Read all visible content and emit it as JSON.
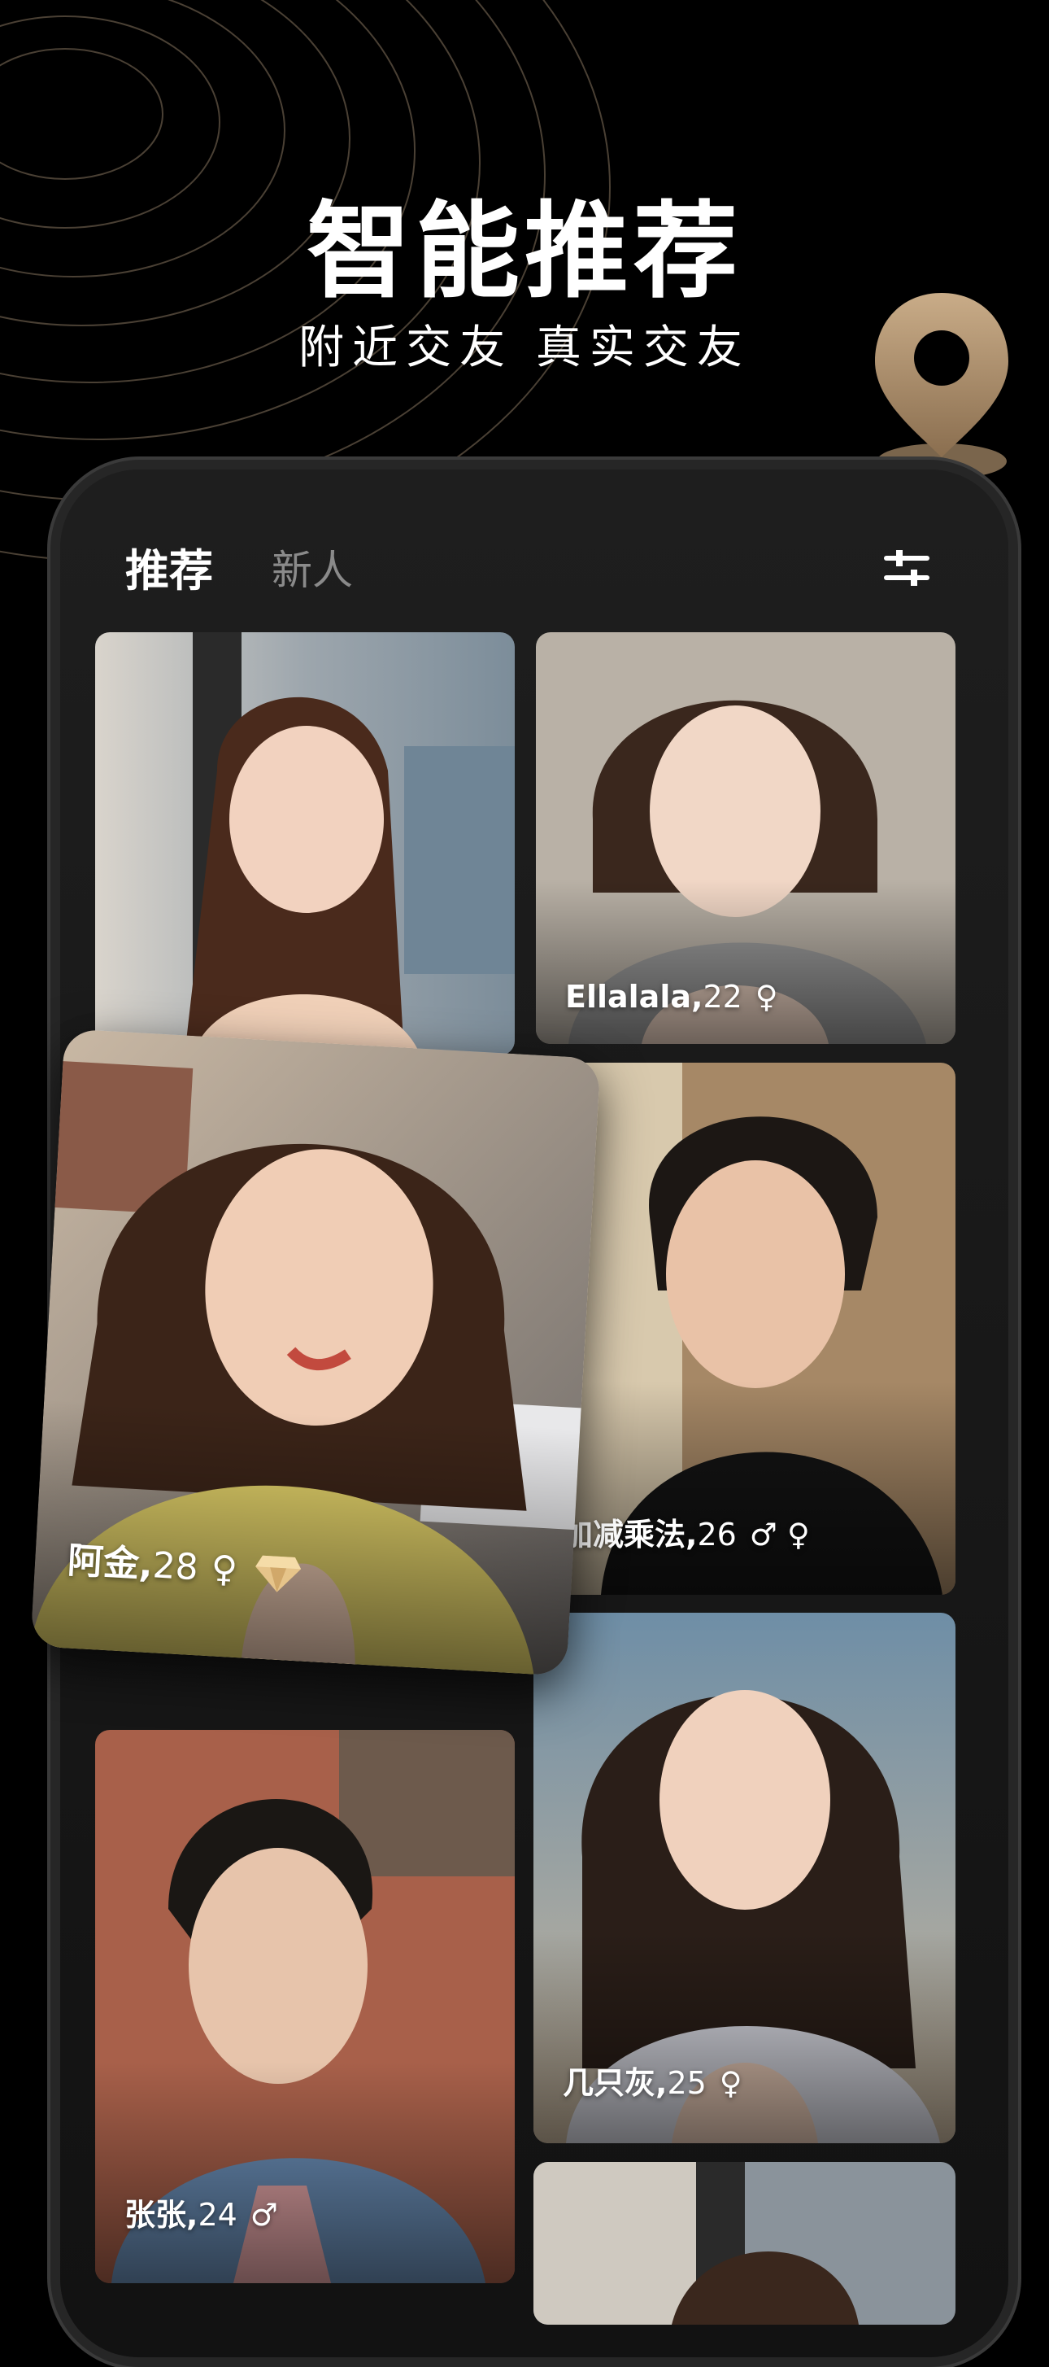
{
  "hero": {
    "title": "智能推荐",
    "subtitle": "附近交友 真实交友"
  },
  "tabs": [
    {
      "label": "推荐",
      "active": true
    },
    {
      "label": "新人",
      "active": false
    }
  ],
  "cards": [
    {
      "name": "",
      "age": "",
      "gender": ""
    },
    {
      "name": "Ellalala,",
      "age": "22",
      "gender": "♀"
    },
    {
      "name": "加减乘法,",
      "age": "26",
      "gender": "♂ ♀"
    },
    {
      "name": "阿金,",
      "age": "28",
      "gender": "♀",
      "badge": "diamond-icon"
    },
    {
      "name": "张张,",
      "age": "24",
      "gender": "♂"
    },
    {
      "name": "几只灰,",
      "age": "25",
      "gender": "♀"
    }
  ],
  "icons": {
    "location": "location-pin-icon",
    "filter": "filter-sliders-icon"
  },
  "colors": {
    "background": "#000000",
    "accent_gold": "#b89a76",
    "tab_inactive": "#8a8a8a"
  }
}
